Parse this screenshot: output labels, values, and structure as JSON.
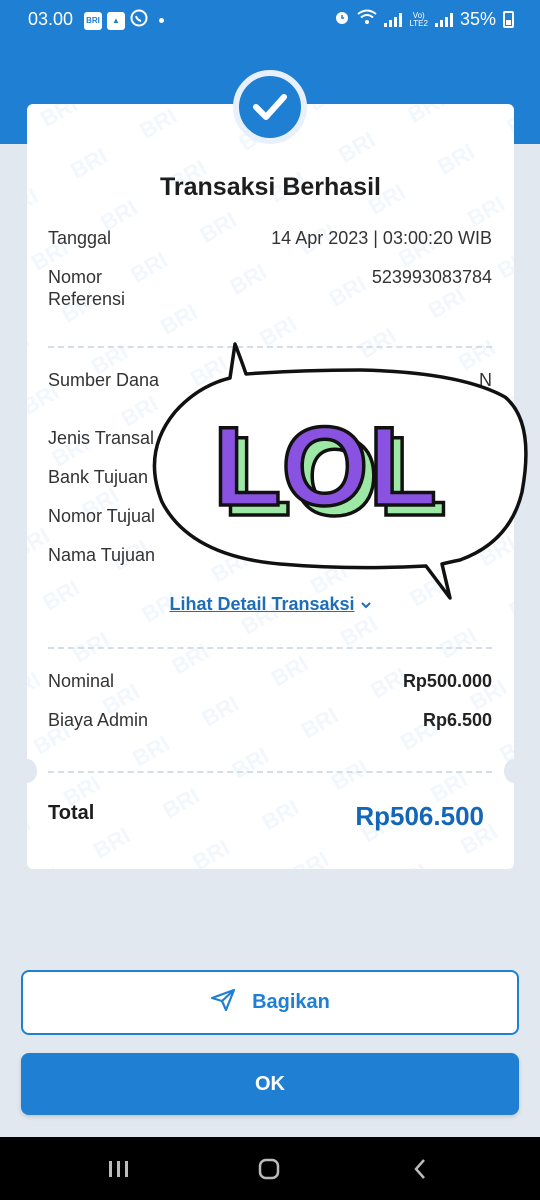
{
  "status_bar": {
    "time": "03.00",
    "battery": "35%",
    "icons": [
      "brimo-icon",
      "gallery-icon",
      "whatsapp-icon",
      "alarm-icon",
      "wifi-icon",
      "signal-icon",
      "volte-icon",
      "battery-icon"
    ]
  },
  "receipt": {
    "title": "Transaksi Berhasil",
    "rows_top": [
      {
        "label": "Tanggal",
        "value": "14 Apr 2023 | 03:00:20 WIB"
      },
      {
        "label": "Nomor\nReferensi",
        "value": "523993083784"
      }
    ],
    "rows_mid": [
      {
        "label": "Sumber Dana",
        "value": "N"
      },
      {
        "label": "Jenis Transal",
        "value": ""
      },
      {
        "label": "Bank Tujuan",
        "value": ""
      },
      {
        "label": "Nomor Tujual",
        "value": ""
      },
      {
        "label": "Nama Tujuan",
        "value": ""
      }
    ],
    "detail_link": "Lihat Detail Transaksi",
    "rows_amount": [
      {
        "label": "Nominal",
        "value": "Rp500.000"
      },
      {
        "label": "Biaya Admin",
        "value": "Rp6.500"
      }
    ],
    "total_label": "Total",
    "total_value": "Rp506.500",
    "watermark_text": "BRI"
  },
  "sticker": {
    "text": "LOL"
  },
  "buttons": {
    "share_label": "Bagikan",
    "ok_label": "OK"
  },
  "colors": {
    "primary": "#1f7fd3",
    "total_value": "#1466b8",
    "background": "#e2e8ef",
    "sticker_fill": "#8a52e0",
    "sticker_side": "#9ee8a6"
  }
}
